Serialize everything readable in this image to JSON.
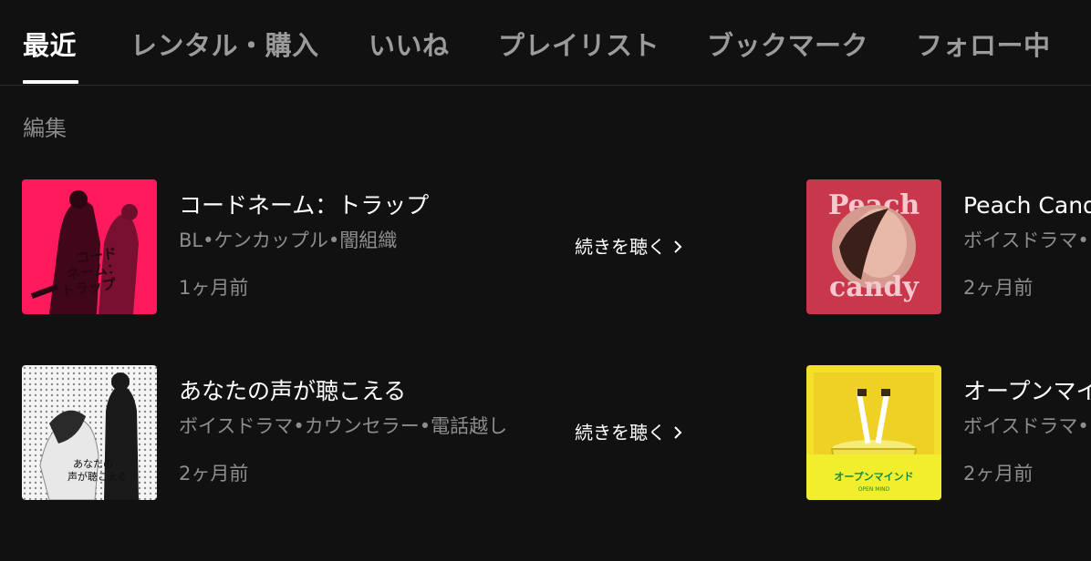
{
  "tabs": [
    {
      "label": "最近",
      "active": true
    },
    {
      "label": "レンタル・購入"
    },
    {
      "label": "いいね"
    },
    {
      "label": "プレイリスト"
    },
    {
      "label": "ブックマーク"
    },
    {
      "label": "フォロー中"
    }
  ],
  "edit_label": "編集",
  "items": [
    {
      "title": "コードネーム：トラップ",
      "tags": "BL•ケンカップル•闇組織",
      "time": "1ヶ月前",
      "action": "続きを聴く",
      "cover": {
        "text": "コード\nネーム：\nトラップ",
        "color": "#ff1a5e"
      }
    },
    {
      "title": "Peach Candy",
      "tags": "ボイスドラマ•",
      "time": "2ヶ月前",
      "cover": {
        "top": "Peach",
        "bottom": "candy",
        "color": "#c9374c"
      }
    },
    {
      "title": "あなたの声が聴こえる",
      "tags": "ボイスドラマ•カウンセラー•電話越し",
      "time": "2ヶ月前",
      "action": "続きを聴く",
      "cover": {
        "line1": "あなたの",
        "line2": "声が聴こえる"
      }
    },
    {
      "title": "オープンマイ",
      "tags": "ボイスドラマ•",
      "time": "2ヶ月前",
      "cover": {
        "text": "オープンマインド",
        "sub": "OPEN MIND",
        "color": "#f2e12c"
      }
    }
  ]
}
